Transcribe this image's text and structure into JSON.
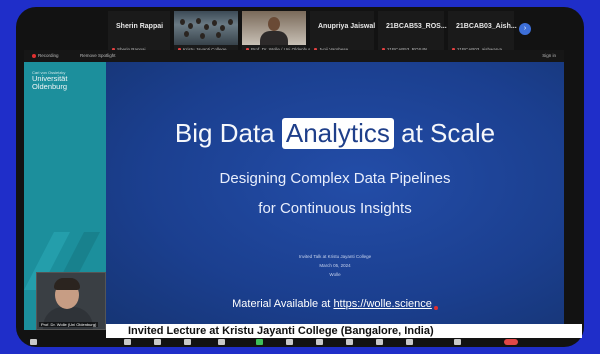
{
  "participants": [
    {
      "name": "Sherin Rappai",
      "sub": "Sherin Rappai",
      "kind": "name"
    },
    {
      "name": "",
      "sub": "Kristu Jayanti College",
      "kind": "crowd"
    },
    {
      "name": "",
      "sub": "Prof. Dr. Wolle / Uni Oldenburg",
      "kind": "man"
    },
    {
      "name": "Anupriya Jaiswal",
      "sub": "Jyoji Varghese",
      "kind": "name"
    },
    {
      "name": "21BCAB53_ROS...",
      "sub": "21BCAB53_ROS4N...",
      "kind": "name"
    },
    {
      "name": "21BCAB03_Aish...",
      "sub": "21BCAB03_aishwarya...",
      "kind": "name"
    }
  ],
  "more_participants_icon": "chevron-right-icon",
  "presenter_bar": {
    "recording": "Recording",
    "spotlight": "Remove Spotlight",
    "sign_in": "Sign in"
  },
  "sidebar_logo": {
    "line1": "Carl von Ossietzky",
    "line2": "Universität",
    "line3": "Oldenburg"
  },
  "slide": {
    "title_pre": "Big Data ",
    "title_highlight": "Analytics",
    "title_post": " at Scale",
    "subtitle_1": "Designing Complex Data Pipelines",
    "subtitle_2": "for Continuous Insights",
    "meta_1": "Invited Talk at Kristu Jayanti College",
    "meta_2": "March 05, 2024",
    "meta_3": "Wolle",
    "material_label": "Material Available at ",
    "material_link": "https://wolle.science"
  },
  "self_view_name": "Prof. Dr. Wolle (Uni Oldenburg)",
  "caption": "Invited Lecture at Kristu Jayanti College (Bangalore, India)",
  "colors": {
    "background": "#1f2ec9",
    "slide_blue": "#1b3f8f",
    "sidebar_teal": "#1c8f9c"
  }
}
